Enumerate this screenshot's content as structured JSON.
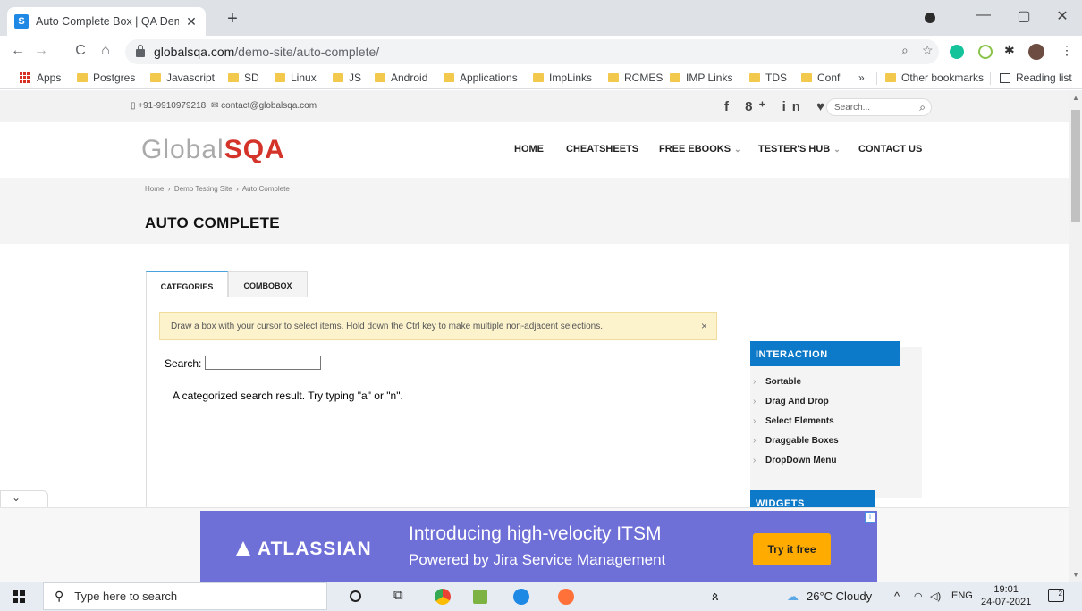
{
  "browser": {
    "tab_title": "Auto Complete Box | QA Demo Testing Site",
    "favicon_letter": "S",
    "tab_close": "✕",
    "new_tab": "+",
    "url_host": "globalsqa.com",
    "url_path": "/demo-site/auto-complete/",
    "window_controls": {
      "minimize": "—",
      "maximize": "▢",
      "close": "✕"
    },
    "nav": {
      "back": "←",
      "forward": "→",
      "reload": "C",
      "home": "⌂"
    },
    "toolbar_icons": {
      "zoom": "⌕",
      "star": "☆",
      "extensions": "✱",
      "menu": "⋮"
    }
  },
  "bookmarks": {
    "apps": "Apps",
    "items": [
      "Postgres",
      "Javascript",
      "SD",
      "Linux",
      "JS",
      "Android",
      "Applications",
      "ImpLinks",
      "RCMES",
      "IMP Links",
      "TDS",
      "Conf"
    ],
    "overflow": "»",
    "other": "Other bookmarks",
    "reading_list": "Reading list"
  },
  "site": {
    "phone": "+91-9910979218",
    "email": "contact@globalsqa.com",
    "social": "f  8⁺ in ♥ ℘",
    "search_placeholder": "Search...",
    "logo_a": "Global",
    "logo_b": "SQA",
    "nav": [
      "HOME",
      "CHEATSHEETS",
      "FREE EBOOKS",
      "TESTER'S HUB",
      "CONTACT US"
    ],
    "breadcrumb": [
      "Home",
      "Demo Testing Site",
      "Auto Complete"
    ],
    "breadcrumb_sep": "›",
    "page_title": "AUTO COMPLETE",
    "tabs": [
      "CATEGORIES",
      "COMBOBOX"
    ],
    "notice": "Draw a box with your cursor to select items. Hold down the Ctrl key to make multiple non-adjacent selections.",
    "notice_close": "×",
    "search_label": "Search:",
    "search_value": "",
    "hint": "A categorized search result. Try typing \"a\" or \"n\".",
    "sidebar": {
      "interaction_title": "INTERACTION",
      "interaction_links": [
        "Sortable",
        "Drag And Drop",
        "Select Elements",
        "Draggable Boxes",
        "DropDown Menu"
      ],
      "widgets_title": "WIDGETS"
    },
    "collapse": "⌄"
  },
  "ad": {
    "brand": "ATLASSIAN",
    "headline": "Introducing high-velocity ITSM",
    "subline": "Powered by Jira Service Management",
    "cta": "Try it free",
    "info": "i"
  },
  "taskbar": {
    "search_placeholder": "Type here to search",
    "weather": "26°C  Cloudy",
    "lang": "ENG",
    "time": "19:01",
    "date": "24-07-2021",
    "notif_count": "2"
  },
  "colors": {
    "brand_red": "#d4332a",
    "sidebar_blue": "#0d79c9",
    "tab_accent": "#4aa3df",
    "ad_purple": "#6f6fd8",
    "ad_button": "#ffab00"
  }
}
